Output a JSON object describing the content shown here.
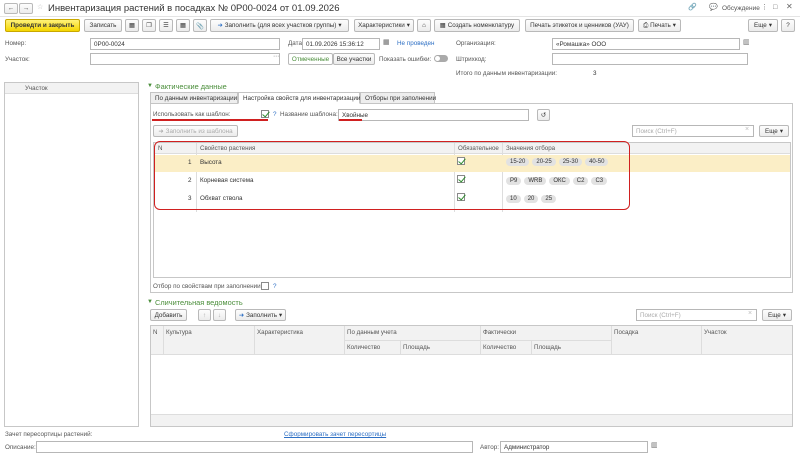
{
  "window": {
    "title": "Инвентаризация растений в посадках № 0Р00-0024 от 01.09.2026",
    "discussion": "Обсуждение"
  },
  "toolbar": {
    "post_close": "Проведти и закрыть",
    "save": "Записать",
    "fill_all": "Заполнить (для всех участков группы)",
    "characteristics": "Характеристики",
    "create_nomenclature": "Создать номенклатуру",
    "print_labels": "Печать этикеток и ценников (УАУ)",
    "print": "Печать",
    "more": "Еще"
  },
  "header": {
    "number_label": "Номер:",
    "number_value": "0Р00-0024",
    "date_label": "Дата:",
    "date_value": "01.09.2026 15:36:12",
    "status": "Не проведен",
    "org_label": "Организация:",
    "org_value": "«Ромашка» ООО",
    "plot_label": "Участок:",
    "marked_btn": "Отмеченные",
    "all_plots_btn": "Все участки",
    "show_errors": "Показать ошибки:",
    "barcode_label": "Штрихкод:",
    "total_label": "Итого по данным инвентаризации:",
    "total_value": "3"
  },
  "left_panel": {
    "column": "Участок"
  },
  "actual": {
    "title": "Фактические данные",
    "tabs": [
      "По данным инвентаризации",
      "Настройка свойств для инвентаризации",
      "Отборы при заполнении"
    ],
    "use_template_label": "Использовать как шаблон:",
    "help": "?",
    "template_name_label": "Название шаблона:",
    "template_name_value": "Хвойные",
    "fill_from_template": "Заполнить из шаблона",
    "search_placeholder": "Поиск (Ctrl+F)",
    "more": "Еще",
    "columns": {
      "n": "N",
      "property": "Свойство растения",
      "required": "Обязательное",
      "values": "Значения отбора"
    },
    "rows": [
      {
        "n": "1",
        "property": "Высота",
        "values": [
          "15-20",
          "20-25",
          "25-30",
          "40-50"
        ]
      },
      {
        "n": "2",
        "property": "Корневая система",
        "values": [
          "P9",
          "WRB",
          "ОКС",
          "C2",
          "C3"
        ]
      },
      {
        "n": "3",
        "property": "Обхват ствола",
        "values": [
          "10",
          "20",
          "25"
        ]
      }
    ],
    "filter_label": "Отбор по свойствам при заполнении:"
  },
  "count": {
    "title": "Сличительная ведомость",
    "add": "Добавить",
    "fill": "Заполнить",
    "search_placeholder": "Поиск (Ctrl+F)",
    "more": "Еще",
    "columns": {
      "n": "N",
      "culture": "Культура",
      "characteristic": "Характеристика",
      "by_account": "По данным учета",
      "qty": "Количество",
      "area": "Площадь",
      "actual": "Фактически",
      "qty2": "Количество",
      "area2": "Площадь",
      "planting": "Посадка",
      "plot": "Участок"
    }
  },
  "footer": {
    "offset_label": "Зачет пересортицы растений:",
    "offset_link": "Сформировать зачет пересортицы",
    "desc_label": "Описание:",
    "author_label": "Автор:",
    "author_value": "Администратор"
  }
}
